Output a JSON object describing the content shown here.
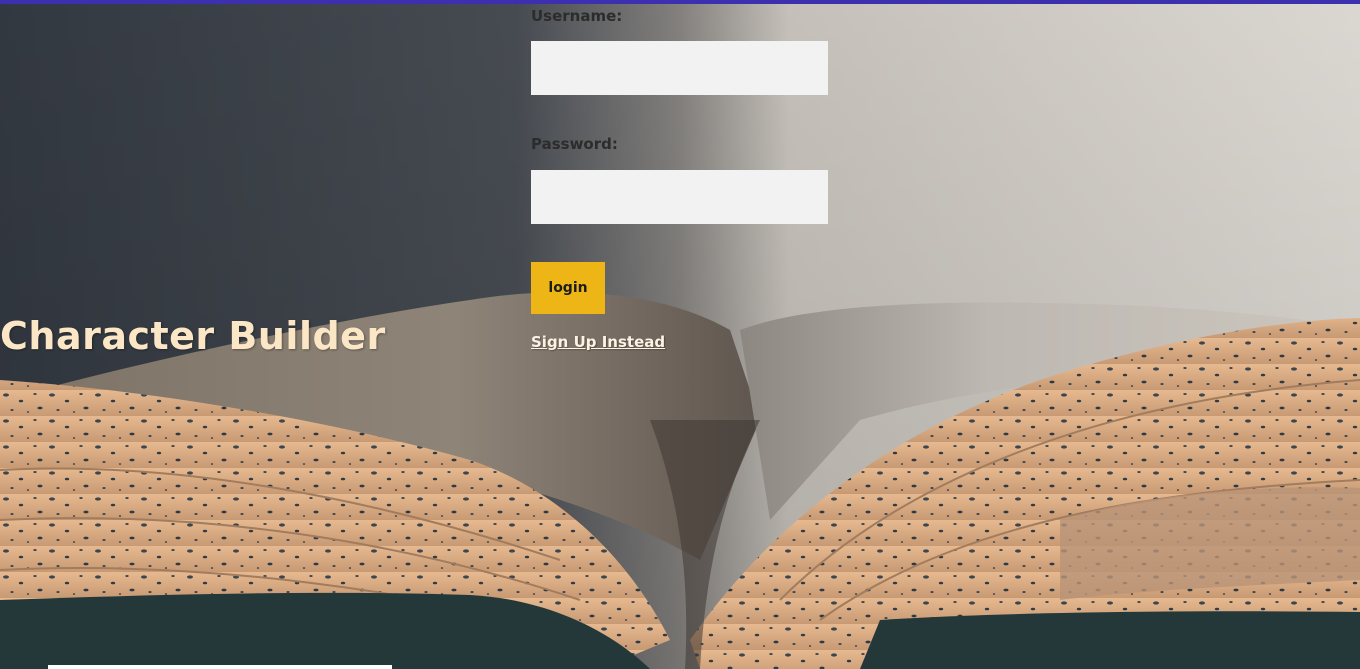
{
  "header": {
    "accent_color": "#3c2fb0"
  },
  "hero": {
    "title": "Character Builder",
    "title_color": "#fbe6c6"
  },
  "login_form": {
    "username_label": "Username:",
    "username_value": "",
    "password_label": "Password:",
    "password_value": "",
    "login_button_label": "login",
    "login_button_color": "#eeb517",
    "signup_link_label": "Sign Up Instead"
  },
  "background": {
    "image_subject": "open-book-photo"
  }
}
